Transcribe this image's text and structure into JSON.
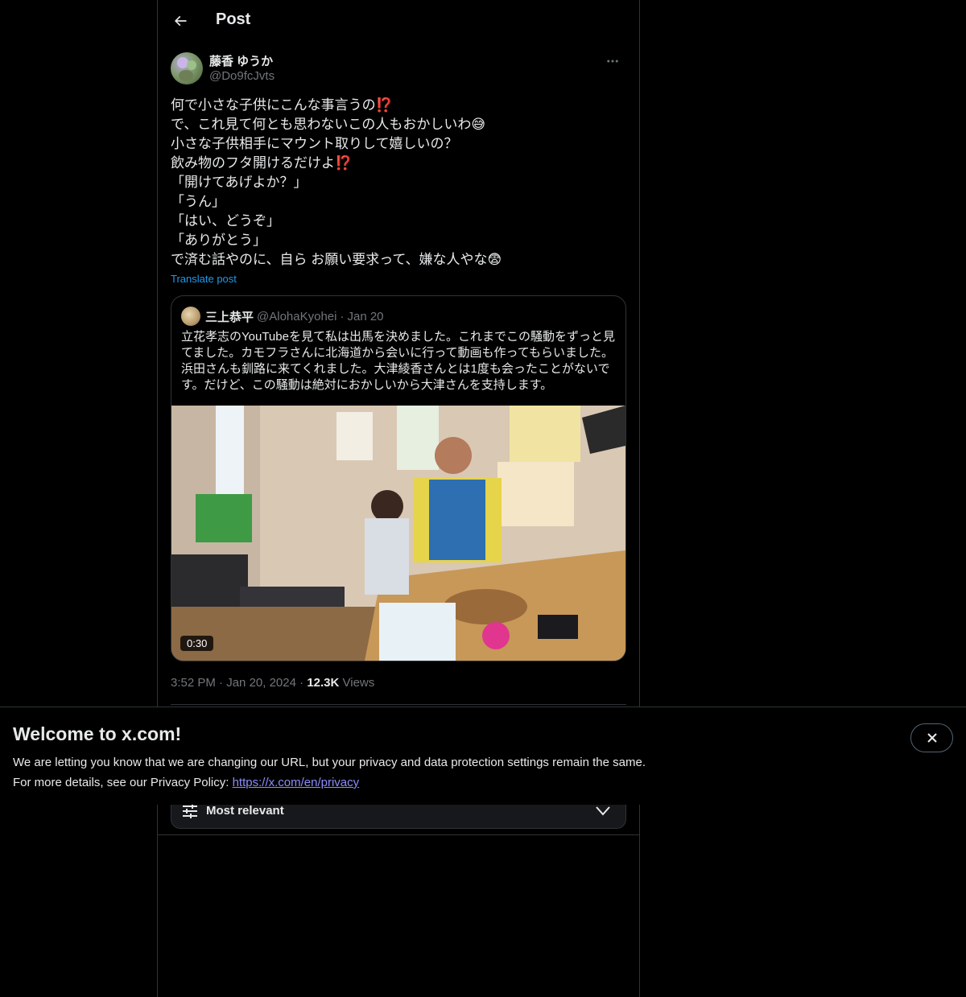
{
  "header": {
    "title": "Post"
  },
  "post": {
    "author_name": "藤香 ゆうか",
    "author_handle": "@Do9fcJvts",
    "text_lines": [
      "何で小さな子供にこんな事言うの⁉️",
      "で、これ見て何とも思わないこの人もおかしいわ😅",
      "小さな子供相手にマウント取りして嬉しいの？",
      "飲み物のフタ開けるだけよ⁉️",
      "「開けてあげよか？」",
      "「うん」",
      "「はい、どうぞ」",
      "「ありがとう」",
      "で済む話やのに、自ら お願い要求って、嫌な人やな😨"
    ],
    "translate_label": "Translate post",
    "time": "3:52 PM",
    "date": "Jan 20, 2024",
    "views_count": "12.3K",
    "views_label": "Views"
  },
  "quote": {
    "name": "三上恭平",
    "handle": "@AlohaKyohei",
    "separator": "·",
    "date": "Jan 20",
    "text_lines": [
      "立花孝志のYouTubeを見て私は出馬を決めました。これまでこの騒動をずっと見",
      "てました。カモフラさんに北海道から会いに行って動画も作ってもらいました。",
      "浜田さんも釧路に来てくれました。大津綾香さんとは1度も会ったことがないで",
      "す。だけど、この騒動は絶対におかしいから大津さんを支持します。"
    ],
    "video_duration": "0:30"
  },
  "sort": {
    "label": "Most relevant"
  },
  "banner": {
    "title": "Welcome to x.com!",
    "line1": "We are letting you know that we are changing our URL, but your privacy and data protection settings remain the same.",
    "line2_prefix": "For more details, see our Privacy Policy: ",
    "link": "https://x.com/en/privacy"
  },
  "meta_separator": "·",
  "icons": {
    "back": "back-arrow-icon",
    "more": "more-dots-icon",
    "sort": "sliders-icon",
    "chevron": "chevron-down-icon",
    "close": "close-icon"
  },
  "colors": {
    "background": "#000000",
    "text": "#e7e9ea",
    "muted": "#71767b",
    "accent": "#1d9bf0",
    "border": "#2f3336",
    "link": "#8c8cff"
  }
}
